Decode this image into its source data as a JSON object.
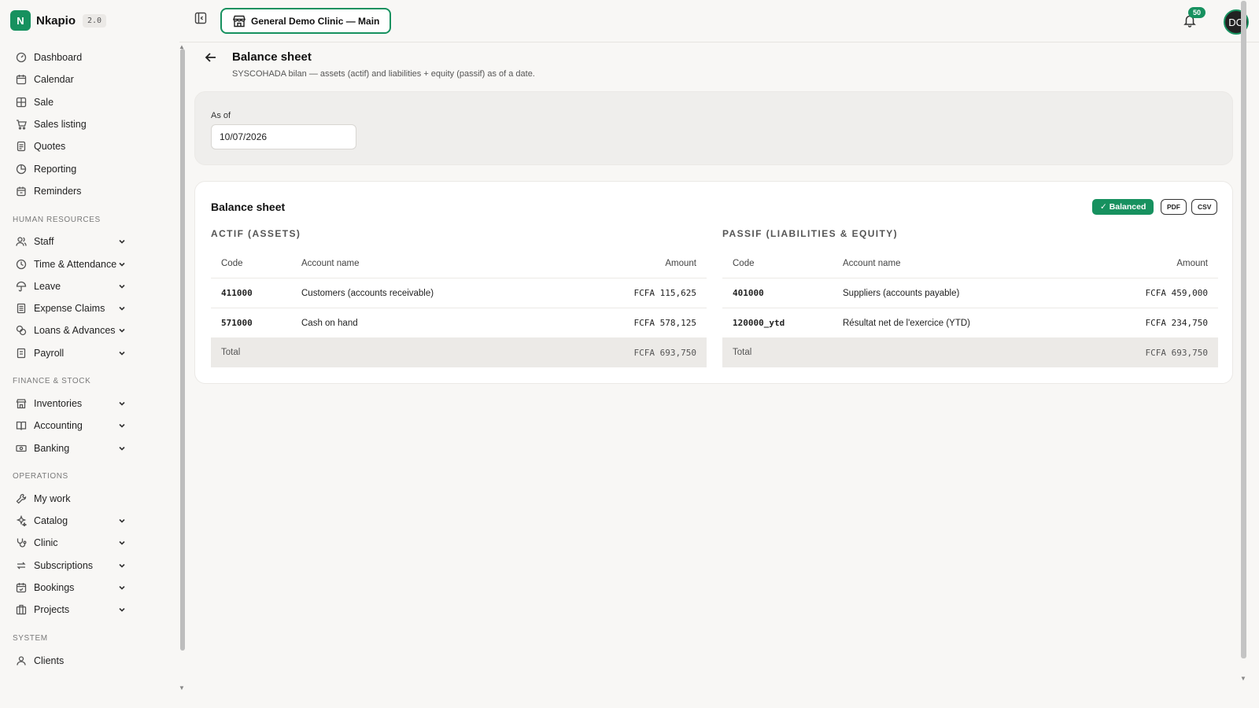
{
  "app": {
    "name": "Nkapio",
    "version": "2.0",
    "logo_letter": "N",
    "accent_color": "#17915f"
  },
  "sidebar": {
    "main_items": [
      {
        "label": "Dashboard",
        "icon": "dashboard-icon"
      },
      {
        "label": "Calendar",
        "icon": "calendar-icon"
      },
      {
        "label": "Sale",
        "icon": "grid-icon"
      },
      {
        "label": "Sales listing",
        "icon": "cart-icon"
      },
      {
        "label": "Quotes",
        "icon": "document-icon"
      },
      {
        "label": "Reporting",
        "icon": "pie-chart-icon"
      },
      {
        "label": "Reminders",
        "icon": "alarm-icon"
      }
    ],
    "hr_title": "HUMAN RESOURCES",
    "hr_items": [
      {
        "label": "Staff",
        "icon": "users-icon"
      },
      {
        "label": "Time & Attendance",
        "icon": "clock-icon"
      },
      {
        "label": "Leave",
        "icon": "umbrella-icon"
      },
      {
        "label": "Expense Claims",
        "icon": "receipt-icon"
      },
      {
        "label": "Loans & Advances",
        "icon": "coins-icon"
      },
      {
        "label": "Payroll",
        "icon": "payroll-icon"
      }
    ],
    "finance_title": "FINANCE & STOCK",
    "finance_items": [
      {
        "label": "Inventories",
        "icon": "store-icon"
      },
      {
        "label": "Accounting",
        "icon": "book-icon"
      },
      {
        "label": "Banking",
        "icon": "banknote-icon"
      }
    ],
    "ops_title": "OPERATIONS",
    "ops_items": [
      {
        "label": "My work",
        "icon": "wrench-icon"
      },
      {
        "label": "Catalog",
        "icon": "sparkle-icon"
      },
      {
        "label": "Clinic",
        "icon": "stethoscope-icon"
      },
      {
        "label": "Subscriptions",
        "icon": "repeat-icon"
      },
      {
        "label": "Bookings",
        "icon": "calendar-check-icon"
      },
      {
        "label": "Projects",
        "icon": "building-icon"
      }
    ],
    "system_title": "SYSTEM",
    "system_items": [
      {
        "label": "Clients",
        "icon": "user-icon"
      }
    ]
  },
  "topbar": {
    "clinic_label": "General Demo Clinic — Main",
    "notification_count": "50",
    "avatar_initials": "DO"
  },
  "page": {
    "title": "Balance sheet",
    "subtitle": "SYSCOHADA bilan — assets (actif) and liabilities + equity (passif) as of a date."
  },
  "filter": {
    "as_of_label": "As of",
    "as_of_value": "10/07/2026"
  },
  "sheet": {
    "title": "Balance sheet",
    "status_badge": "✓ Balanced",
    "pdf_label": "PDF",
    "csv_label": "CSV",
    "actif": {
      "title": "ACTIF (ASSETS)",
      "headers": {
        "code": "Code",
        "name": "Account name",
        "amount": "Amount"
      },
      "rows": [
        {
          "code": "411000",
          "name": "Customers (accounts receivable)",
          "amount": "FCFA 115,625"
        },
        {
          "code": "571000",
          "name": "Cash on hand",
          "amount": "FCFA 578,125"
        }
      ],
      "total_label": "Total",
      "total_amount": "FCFA 693,750"
    },
    "passif": {
      "title": "PASSIF (LIABILITIES & EQUITY)",
      "headers": {
        "code": "Code",
        "name": "Account name",
        "amount": "Amount"
      },
      "rows": [
        {
          "code": "401000",
          "name": "Suppliers (accounts payable)",
          "amount": "FCFA 459,000"
        },
        {
          "code": "120000_ytd",
          "name": "Résultat net de l'exercice (YTD)",
          "amount": "FCFA 234,750"
        }
      ],
      "total_label": "Total",
      "total_amount": "FCFA 693,750"
    }
  }
}
